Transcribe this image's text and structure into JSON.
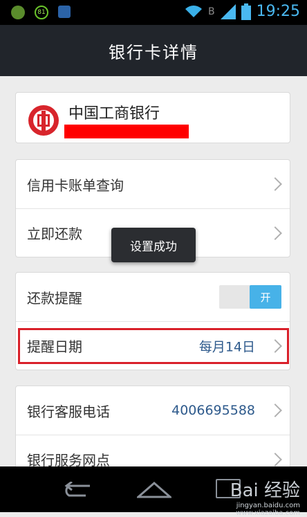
{
  "status_bar": {
    "time": "19:25",
    "battery_badge": "81",
    "network_label": "B"
  },
  "header": {
    "title": "银行卡详情"
  },
  "bank": {
    "name": "中国工商银行"
  },
  "menu_card": {
    "items": [
      {
        "label": "信用卡账单查询"
      },
      {
        "label": "立即还款"
      }
    ]
  },
  "reminder_card": {
    "reminder_label": "还款提醒",
    "toggle_on_label": "开",
    "toggle_state": "on",
    "date_label": "提醒日期",
    "date_value": "每月14日"
  },
  "service_card": {
    "phone_label": "银行客服电话",
    "phone_value": "4006695588",
    "branches_label": "银行服务网点"
  },
  "toast": {
    "text": "设置成功"
  },
  "watermark": {
    "brand": "Bai 经验",
    "url": "jingyan.baidu.com",
    "url2": "www.xiazaiba.com"
  },
  "colors": {
    "accent": "#47b2e8",
    "title_bar": "#21252b",
    "highlight": "#d9202a",
    "value_text": "#2e5a8c"
  },
  "icons": [
    "app-icon-green",
    "battery-ring-icon",
    "app-icon-blue",
    "wifi-icon",
    "signal-icon",
    "battery-icon",
    "bank-logo-icon",
    "chevron-right-icon",
    "back-icon",
    "home-icon",
    "recent-apps-icon"
  ]
}
